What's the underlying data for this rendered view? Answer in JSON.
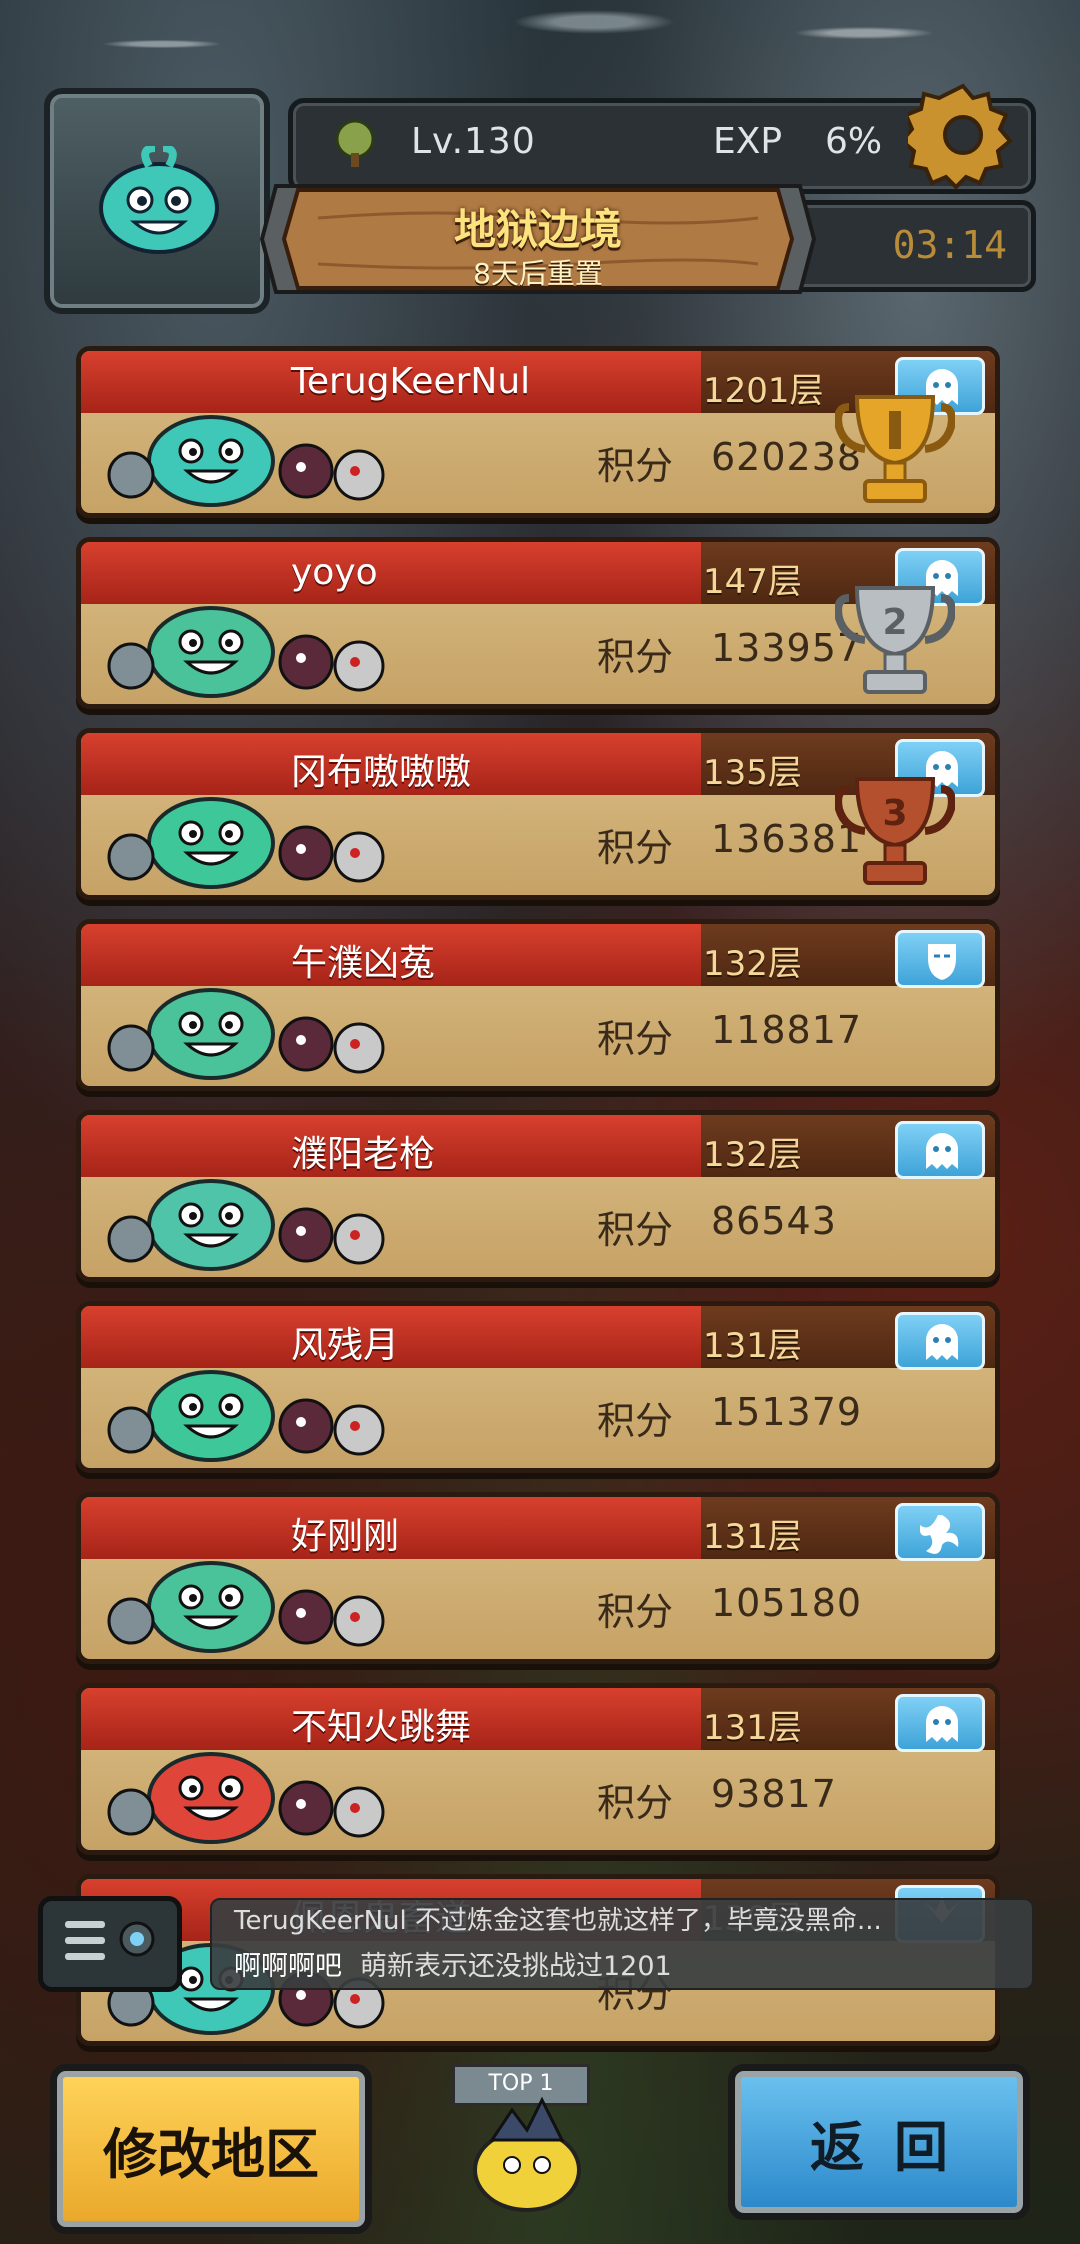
{
  "header": {
    "level": "Lv.130",
    "exp_label": "EXP",
    "exp_value": "6%",
    "title": "地狱边境",
    "subtitle": "8天后重置",
    "timer": "03:14"
  },
  "ranking": [
    {
      "name": "TerugKeerNul",
      "floor": "1201层",
      "score_label": "积分",
      "score": "620238",
      "badge": "ghost-icon",
      "trophy": "gold"
    },
    {
      "name": "yoyo",
      "floor": "147层",
      "score_label": "积分",
      "score": "133957",
      "badge": "ghost-icon",
      "trophy": "silver"
    },
    {
      "name": "冈布嗷嗷嗷",
      "floor": "135层",
      "score_label": "积分",
      "score": "136381",
      "badge": "ghost-icon",
      "trophy": "bronze"
    },
    {
      "name": "午濮凶菟",
      "floor": "132层",
      "score_label": "积分",
      "score": "118817",
      "badge": "mask-icon",
      "trophy": ""
    },
    {
      "name": "濮阳老枪",
      "floor": "132层",
      "score_label": "积分",
      "score": "86543",
      "badge": "ghost-icon",
      "trophy": ""
    },
    {
      "name": "风残月",
      "floor": "131层",
      "score_label": "积分",
      "score": "151379",
      "badge": "ghost-icon",
      "trophy": ""
    },
    {
      "name": "好刚刚",
      "floor": "131层",
      "score_label": "积分",
      "score": "105180",
      "badge": "swirl-icon",
      "trophy": ""
    },
    {
      "name": "不知火跳舞",
      "floor": "131层",
      "score_label": "积分",
      "score": "93817",
      "badge": "ghost-icon",
      "trophy": ""
    },
    {
      "name": "佩恩鬼畜道",
      "floor": "130层",
      "score_label": "积分",
      "score": "",
      "badge": "wings-icon",
      "trophy": ""
    }
  ],
  "trophy_numbers": {
    "silver": "2",
    "bronze": "3"
  },
  "chat": {
    "line1": "TerugKeerNul  不过炼金这套也就这样了，毕竟没黑命...",
    "line2_sender": "啊啊啊吧",
    "line2_text": "萌新表示还没挑战过1201"
  },
  "buttons": {
    "region": "修改地区",
    "back": "返回"
  },
  "top_tag": "TOP 1",
  "colors": {
    "card_red": "#c23323",
    "card_body": "#d2b378",
    "badge_blue": "#5bb9e8",
    "button_yellow": "#f3bd3f",
    "button_blue": "#4aa5dc"
  }
}
